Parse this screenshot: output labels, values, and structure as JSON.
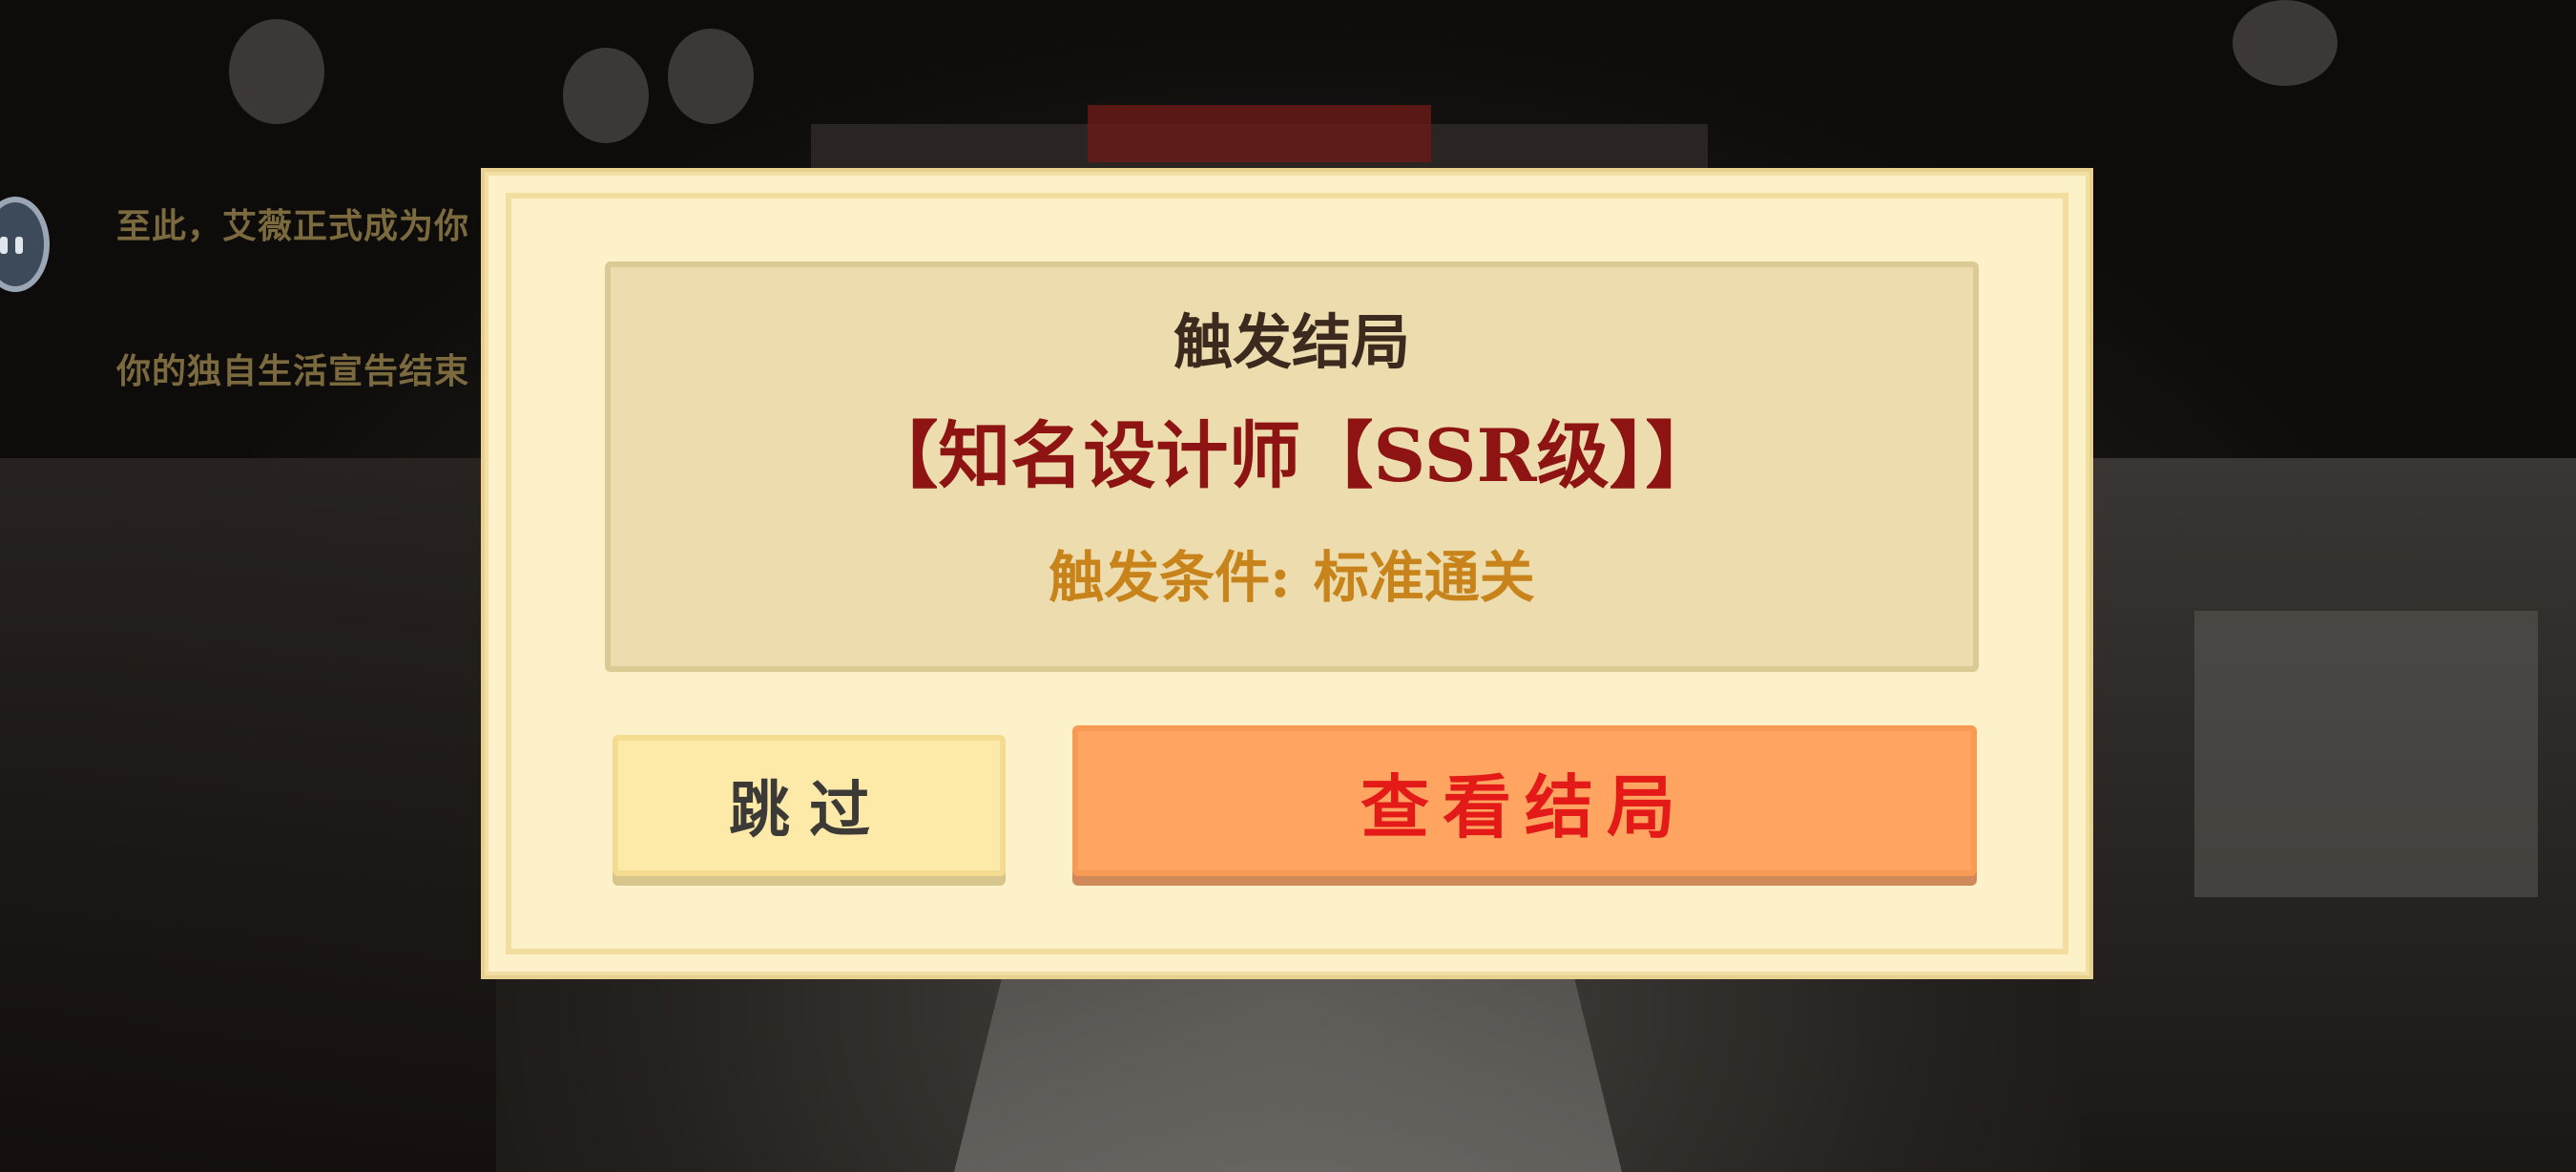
{
  "narration": {
    "line1": "至此，艾薇正式成为你",
    "line2": "你的独自生活宣告结束"
  },
  "dialog": {
    "title": "触发结局",
    "ending_name": "【知名设计师【SSR级】】",
    "condition_label": "触发条件:",
    "condition_value": "标准通关",
    "skip_label": "跳过",
    "view_label": "查看结局"
  },
  "colors": {
    "dialog_bg": "#fdf1c9",
    "panel_bg": "#ecdcae",
    "ending_name": "#8e1413",
    "condition": "#c8841a",
    "view_button_bg": "#ffa561",
    "view_button_text": "#e41a18",
    "skip_button_bg": "#fde9a8"
  }
}
